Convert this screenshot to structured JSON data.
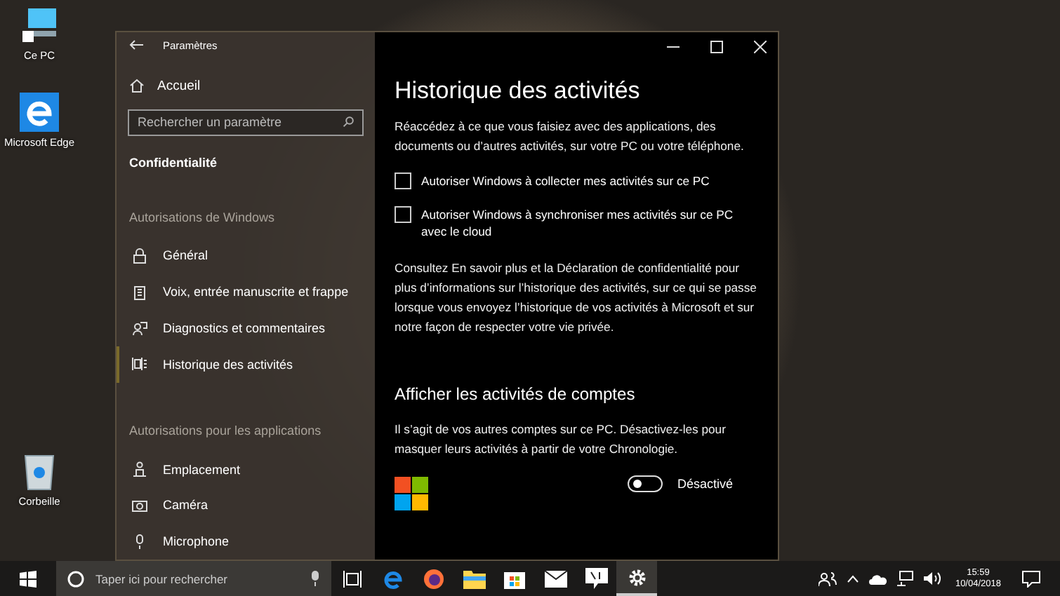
{
  "desktop_icons": [
    {
      "label": "Ce PC",
      "kind": "pc"
    },
    {
      "label": "Microsoft Edge",
      "kind": "edge"
    },
    {
      "label": "Corbeille",
      "kind": "bin"
    }
  ],
  "window": {
    "title": "Paramètres",
    "sidebar": {
      "home": "Accueil",
      "search_placeholder": "Rechercher un paramètre",
      "section": "Confidentialité",
      "groups": [
        {
          "heading": "Autorisations de Windows",
          "items": [
            {
              "label": "Général",
              "kind": "lock",
              "selected": false
            },
            {
              "label": "Voix, entrée manuscrite et frappe",
              "kind": "clipboard",
              "selected": false
            },
            {
              "label": "Diagnostics et commentaires",
              "kind": "feedback",
              "selected": false
            },
            {
              "label": "Historique des activités",
              "kind": "timeline",
              "selected": true
            }
          ]
        },
        {
          "heading": "Autorisations pour les applications",
          "items": [
            {
              "label": "Emplacement",
              "kind": "location",
              "selected": false
            },
            {
              "label": "Caméra",
              "kind": "camera",
              "selected": false
            },
            {
              "label": "Microphone",
              "kind": "mic",
              "selected": false
            }
          ]
        }
      ]
    },
    "content": {
      "title": "Historique des activités",
      "intro": "Réaccédez à ce que vous faisiez avec des applications, des documents ou d’autres activités, sur votre PC ou votre téléphone.",
      "checkboxes": [
        {
          "label": "Autoriser Windows à collecter mes activités sur ce PC",
          "checked": false
        },
        {
          "label": "Autoriser Windows à synchroniser mes activités sur ce PC avec le cloud",
          "checked": false
        }
      ],
      "info": "Consultez En savoir plus et la Déclaration de confidentialité pour plus d’informations sur l’historique des activités, sur ce qui se passe lorsque vous envoyez l’historique de vos activités à Microsoft et sur notre façon de respecter votre vie privée.",
      "accounts_heading": "Afficher les activités de comptes",
      "accounts_text": "Il s’agit de vos autres comptes sur ce PC. Désactivez-les pour masquer leurs activités à partir de votre Chronologie.",
      "account_toggle": {
        "on": false,
        "label": "Désactivé"
      }
    }
  },
  "taskbar": {
    "search_placeholder": "Taper ici pour rechercher",
    "apps": [
      {
        "kind": "taskview",
        "selected": false
      },
      {
        "kind": "edge",
        "selected": false
      },
      {
        "kind": "firefox",
        "selected": false
      },
      {
        "kind": "folder",
        "selected": false
      },
      {
        "kind": "store",
        "selected": false
      },
      {
        "kind": "mail",
        "selected": false
      },
      {
        "kind": "feedback",
        "selected": false
      },
      {
        "kind": "gear",
        "selected": true
      }
    ],
    "time": "15:59",
    "date": "10/04/2018"
  }
}
